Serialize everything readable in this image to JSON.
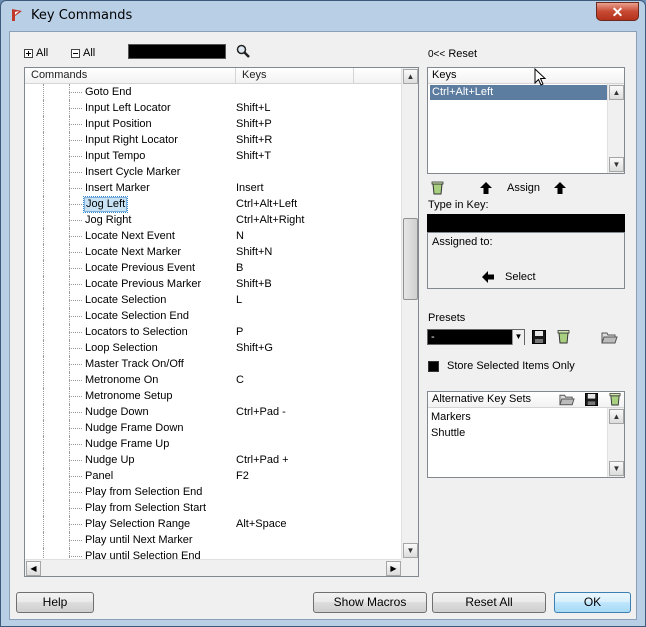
{
  "window": {
    "title": "Key Commands",
    "close_label": "✕"
  },
  "toolbar": {
    "expand_all": "All",
    "collapse_all": "All",
    "search_value": ""
  },
  "columns": {
    "commands": "Commands",
    "keys": "Keys"
  },
  "commands": [
    {
      "name": "Goto End",
      "key": ""
    },
    {
      "name": "Input Left Locator",
      "key": "Shift+L"
    },
    {
      "name": "Input Position",
      "key": "Shift+P"
    },
    {
      "name": "Input Right Locator",
      "key": "Shift+R"
    },
    {
      "name": "Input Tempo",
      "key": "Shift+T"
    },
    {
      "name": "Insert Cycle Marker",
      "key": ""
    },
    {
      "name": "Insert Marker",
      "key": "Insert"
    },
    {
      "name": "Jog Left",
      "key": "Ctrl+Alt+Left",
      "selected": true
    },
    {
      "name": "Jog Right",
      "key": "Ctrl+Alt+Right"
    },
    {
      "name": "Locate Next Event",
      "key": "N"
    },
    {
      "name": "Locate Next Marker",
      "key": "Shift+N"
    },
    {
      "name": "Locate Previous Event",
      "key": "B"
    },
    {
      "name": "Locate Previous Marker",
      "key": "Shift+B"
    },
    {
      "name": "Locate Selection",
      "key": "L"
    },
    {
      "name": "Locate Selection End",
      "key": ""
    },
    {
      "name": "Locators to Selection",
      "key": "P"
    },
    {
      "name": "Loop Selection",
      "key": "Shift+G"
    },
    {
      "name": "Master Track On/Off",
      "key": ""
    },
    {
      "name": "Metronome On",
      "key": "C"
    },
    {
      "name": "Metronome Setup",
      "key": ""
    },
    {
      "name": "Nudge Down",
      "key": "Ctrl+Pad -"
    },
    {
      "name": "Nudge Frame Down",
      "key": ""
    },
    {
      "name": "Nudge Frame Up",
      "key": ""
    },
    {
      "name": "Nudge Up",
      "key": "Ctrl+Pad +"
    },
    {
      "name": "Panel",
      "key": "F2"
    },
    {
      "name": "Play from Selection End",
      "key": ""
    },
    {
      "name": "Play from Selection Start",
      "key": ""
    },
    {
      "name": "Play Selection Range",
      "key": "Alt+Space"
    },
    {
      "name": "Play until Next Marker",
      "key": ""
    },
    {
      "name": "Play until Selection End",
      "key": ""
    }
  ],
  "right": {
    "reset_label": "Reset",
    "keys_header": "Keys",
    "key_binding": "Ctrl+Alt+Left",
    "assign_label": "Assign",
    "type_in_key_label": "Type in Key:",
    "type_in_key_value": "",
    "assigned_to_label": "Assigned to:",
    "select_label": "Select",
    "presets_label": "Presets",
    "preset_value": "-",
    "store_selected_label": "Store Selected Items Only",
    "alt_key_sets_label": "Alternative Key Sets",
    "alt_key_sets": [
      "Markers",
      "Shuttle"
    ]
  },
  "buttons": {
    "help": "Help",
    "show_macros": "Show Macros",
    "reset_all": "Reset All",
    "ok": "OK"
  },
  "colors": {
    "selection": "#5c7d9f",
    "app_icon": "#c0392b"
  }
}
